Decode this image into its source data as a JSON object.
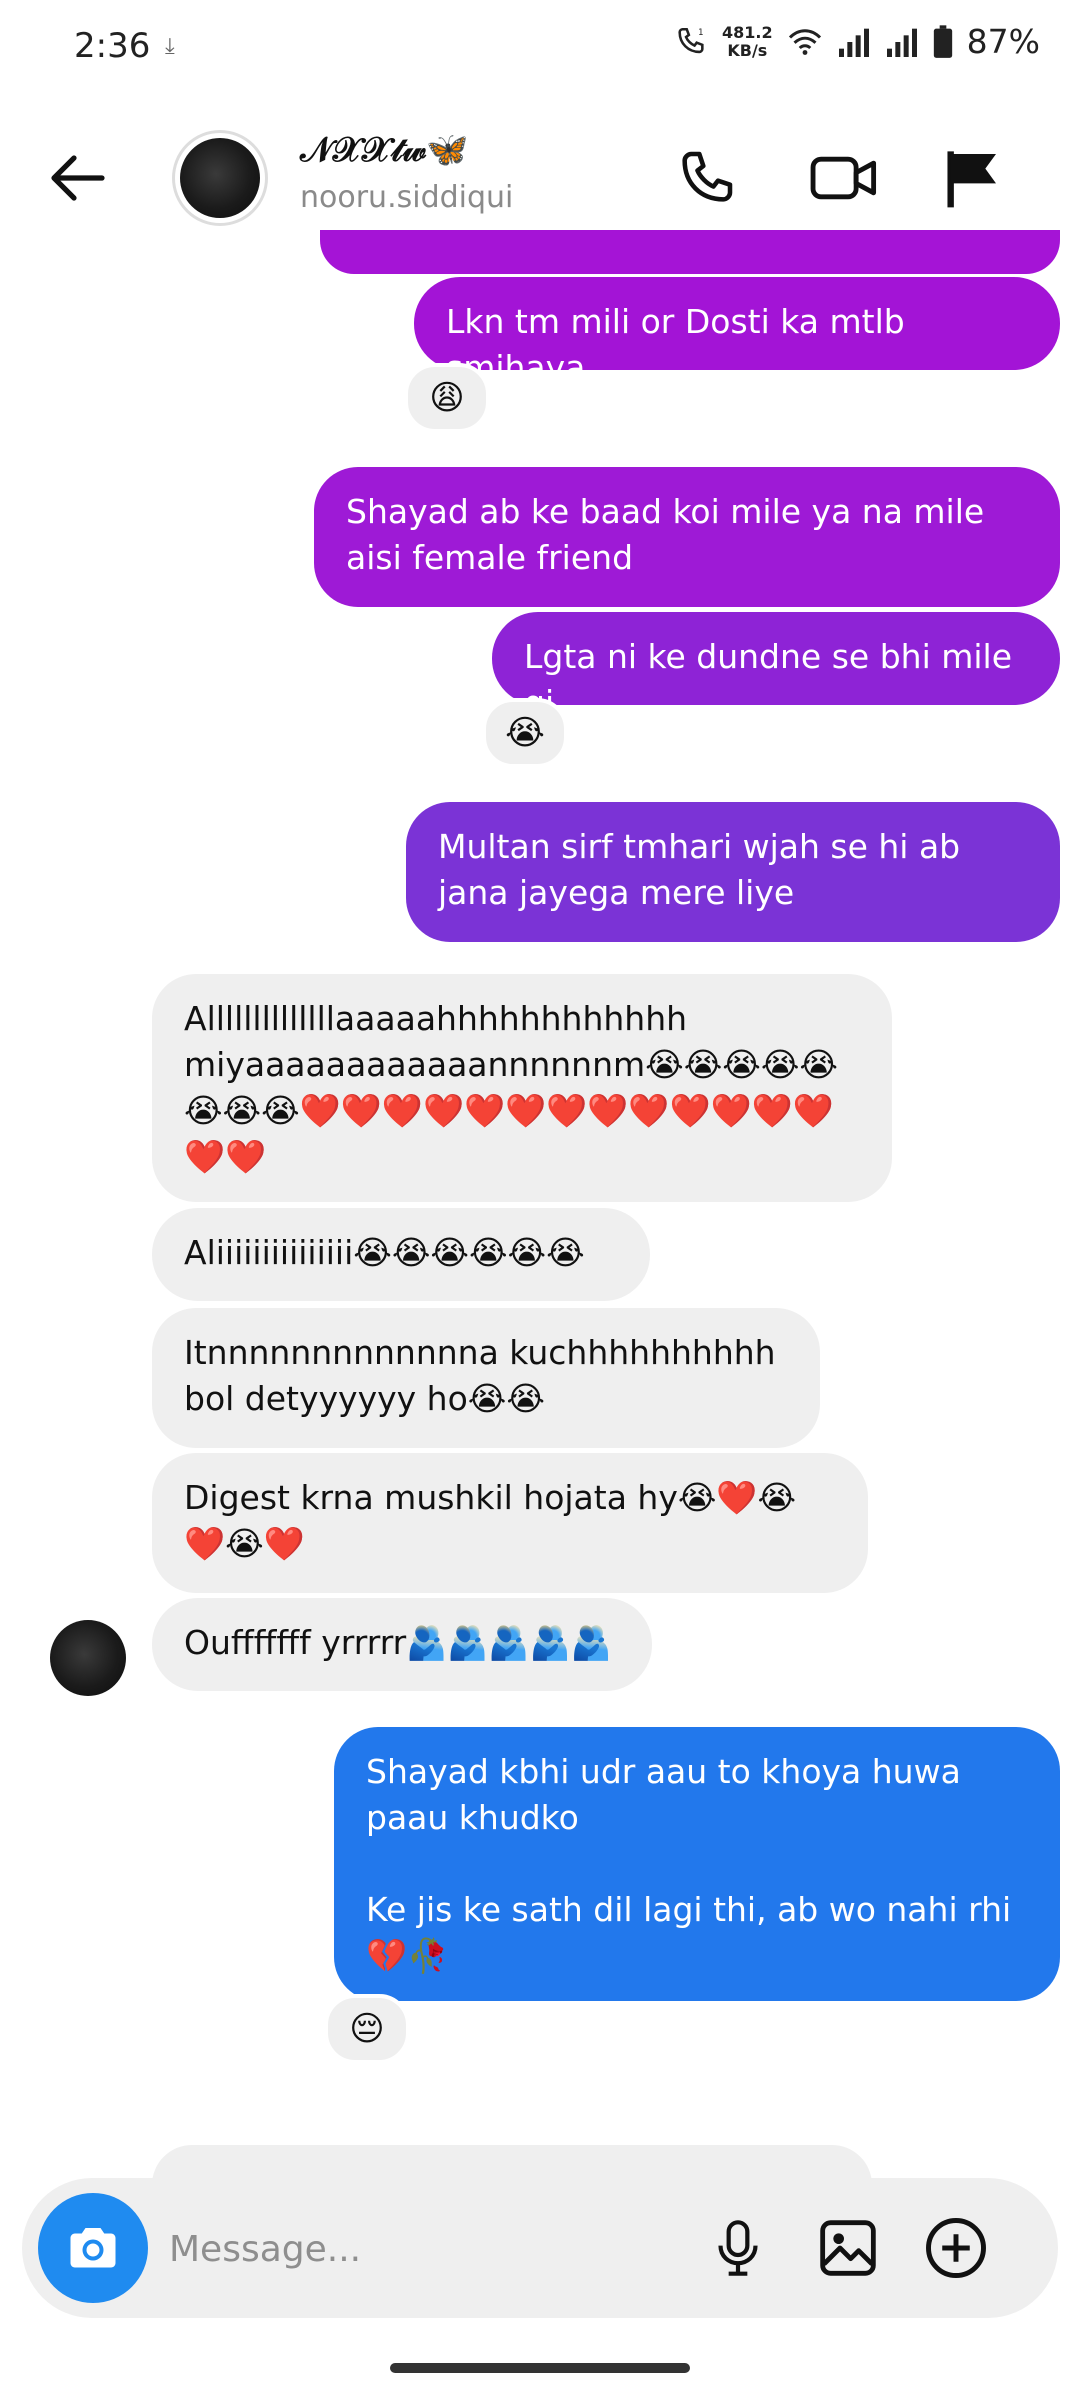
{
  "status_bar": {
    "time": "2:36",
    "download_icon": "download-icon",
    "speed_value": "481.2",
    "speed_unit": "KB/s",
    "battery": "87%"
  },
  "header": {
    "display_name": "𝒩𝒳𝒳𝓉𝓌🦋",
    "username": "nooru.siddiqui"
  },
  "messages": [
    {
      "id": "m1",
      "side": "out",
      "text": "Lkn tm mili or Dosti ka mtlb smjhaya",
      "reaction": "😩"
    },
    {
      "id": "m2",
      "side": "out",
      "text": "Shayad ab ke baad koi mile ya na mile aisi female friend",
      "reaction": ""
    },
    {
      "id": "m3",
      "side": "out",
      "text": "Lgta ni ke dundne se bhi mile gi",
      "reaction": "😭"
    },
    {
      "id": "m4",
      "side": "out",
      "text": "Multan sirf tmhari wjah se hi ab jana jayega mere liye",
      "reaction": ""
    },
    {
      "id": "m5",
      "side": "in",
      "text": "Allllllllllllllaaaaahhhhhhhhhhhh miyaaaaaaaaaaaannnnnnm😭😭😭😭😭😭😭😭❤️❤️❤️❤️❤️❤️❤️❤️❤️❤️❤️❤️❤️❤️❤️",
      "reaction": ""
    },
    {
      "id": "m6",
      "side": "in",
      "text": "Aliiiiiiiiiiiiiii😭😭😭😭😭😭",
      "reaction": ""
    },
    {
      "id": "m7",
      "side": "in",
      "text": "Itnnnnnnnnnnnnna kuchhhhhhhhhh bol detyyyyyy ho😭😭",
      "reaction": ""
    },
    {
      "id": "m8",
      "side": "in",
      "text": "Digest krna mushkil hojata hy😭❤️😭❤️😭❤️",
      "reaction": ""
    },
    {
      "id": "m9",
      "side": "in",
      "text": "Oufffffff yrrrrr🫂🫂🫂🫂🫂",
      "reaction": ""
    },
    {
      "id": "m10",
      "side": "out",
      "text": "Shayad kbhi udr aau to khoya huwa paau khudko\n\nKe jis ke sath dil lagi thi, ab wo nahi rhi💔🥀",
      "reaction": "😔"
    }
  ],
  "composer": {
    "placeholder": "Message..."
  },
  "colors": {
    "outgoing_top": "#a313d6",
    "outgoing_mid": "#7c33d6",
    "outgoing_bottom": "#2178ec",
    "incoming": "#efefef",
    "camera_button": "#1f8bf0"
  },
  "icons": [
    "back-arrow-icon",
    "phone-icon",
    "video-call-icon",
    "flag-icon",
    "camera-icon",
    "microphone-icon",
    "gallery-icon",
    "add-icon"
  ]
}
